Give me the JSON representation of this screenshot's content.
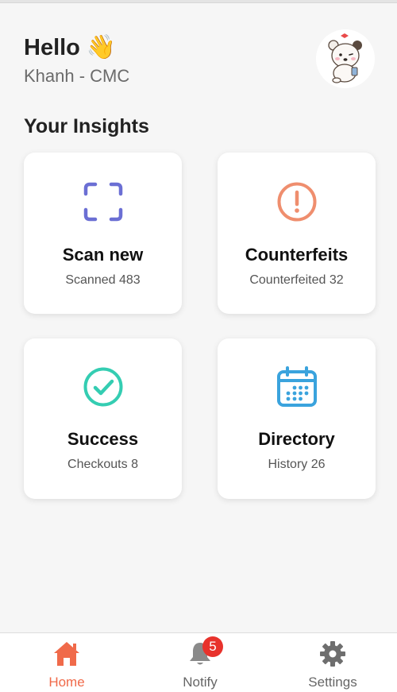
{
  "header": {
    "greeting": "Hello",
    "wave_emoji": "👋",
    "user_line": "Khanh - CMC"
  },
  "section_title": "Your Insights",
  "cards": [
    {
      "title": "Scan new",
      "subtitle": "Scanned 483",
      "icon": "scan-frame-icon",
      "color": "#6b6fd4"
    },
    {
      "title": "Counterfeits",
      "subtitle": "Counterfeited 32",
      "icon": "alert-circle-icon",
      "color": "#ef8e6e"
    },
    {
      "title": "Success",
      "subtitle": "Checkouts 8",
      "icon": "check-circle-icon",
      "color": "#34cdb2"
    },
    {
      "title": "Directory",
      "subtitle": "History 26",
      "icon": "calendar-icon",
      "color": "#3aa3dd"
    }
  ],
  "nav": [
    {
      "label": "Home",
      "icon": "home-icon",
      "active": true,
      "color": "#f06a4a"
    },
    {
      "label": "Notify",
      "icon": "bell-icon",
      "badge": "5",
      "color": "#757575"
    },
    {
      "label": "Settings",
      "icon": "gear-icon",
      "color": "#757575"
    }
  ]
}
